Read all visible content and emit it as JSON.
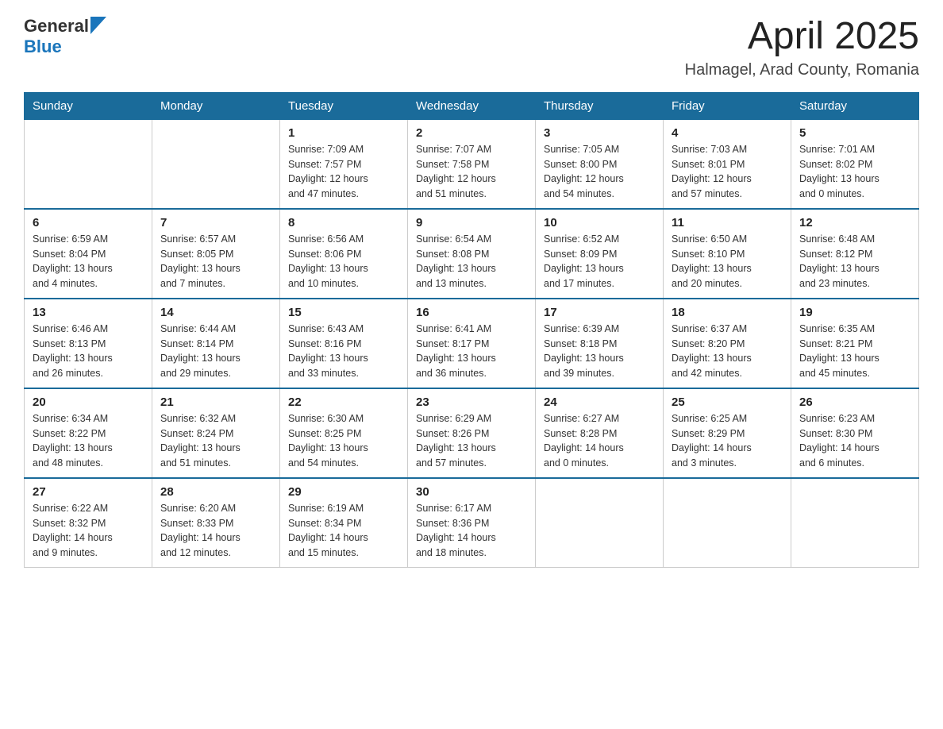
{
  "header": {
    "logo": {
      "general": "General",
      "blue": "Blue"
    },
    "title": "April 2025",
    "location": "Halmagel, Arad County, Romania"
  },
  "calendar": {
    "days_of_week": [
      "Sunday",
      "Monday",
      "Tuesday",
      "Wednesday",
      "Thursday",
      "Friday",
      "Saturday"
    ],
    "weeks": [
      [
        {
          "day": "",
          "info": ""
        },
        {
          "day": "",
          "info": ""
        },
        {
          "day": "1",
          "info": "Sunrise: 7:09 AM\nSunset: 7:57 PM\nDaylight: 12 hours\nand 47 minutes."
        },
        {
          "day": "2",
          "info": "Sunrise: 7:07 AM\nSunset: 7:58 PM\nDaylight: 12 hours\nand 51 minutes."
        },
        {
          "day": "3",
          "info": "Sunrise: 7:05 AM\nSunset: 8:00 PM\nDaylight: 12 hours\nand 54 minutes."
        },
        {
          "day": "4",
          "info": "Sunrise: 7:03 AM\nSunset: 8:01 PM\nDaylight: 12 hours\nand 57 minutes."
        },
        {
          "day": "5",
          "info": "Sunrise: 7:01 AM\nSunset: 8:02 PM\nDaylight: 13 hours\nand 0 minutes."
        }
      ],
      [
        {
          "day": "6",
          "info": "Sunrise: 6:59 AM\nSunset: 8:04 PM\nDaylight: 13 hours\nand 4 minutes."
        },
        {
          "day": "7",
          "info": "Sunrise: 6:57 AM\nSunset: 8:05 PM\nDaylight: 13 hours\nand 7 minutes."
        },
        {
          "day": "8",
          "info": "Sunrise: 6:56 AM\nSunset: 8:06 PM\nDaylight: 13 hours\nand 10 minutes."
        },
        {
          "day": "9",
          "info": "Sunrise: 6:54 AM\nSunset: 8:08 PM\nDaylight: 13 hours\nand 13 minutes."
        },
        {
          "day": "10",
          "info": "Sunrise: 6:52 AM\nSunset: 8:09 PM\nDaylight: 13 hours\nand 17 minutes."
        },
        {
          "day": "11",
          "info": "Sunrise: 6:50 AM\nSunset: 8:10 PM\nDaylight: 13 hours\nand 20 minutes."
        },
        {
          "day": "12",
          "info": "Sunrise: 6:48 AM\nSunset: 8:12 PM\nDaylight: 13 hours\nand 23 minutes."
        }
      ],
      [
        {
          "day": "13",
          "info": "Sunrise: 6:46 AM\nSunset: 8:13 PM\nDaylight: 13 hours\nand 26 minutes."
        },
        {
          "day": "14",
          "info": "Sunrise: 6:44 AM\nSunset: 8:14 PM\nDaylight: 13 hours\nand 29 minutes."
        },
        {
          "day": "15",
          "info": "Sunrise: 6:43 AM\nSunset: 8:16 PM\nDaylight: 13 hours\nand 33 minutes."
        },
        {
          "day": "16",
          "info": "Sunrise: 6:41 AM\nSunset: 8:17 PM\nDaylight: 13 hours\nand 36 minutes."
        },
        {
          "day": "17",
          "info": "Sunrise: 6:39 AM\nSunset: 8:18 PM\nDaylight: 13 hours\nand 39 minutes."
        },
        {
          "day": "18",
          "info": "Sunrise: 6:37 AM\nSunset: 8:20 PM\nDaylight: 13 hours\nand 42 minutes."
        },
        {
          "day": "19",
          "info": "Sunrise: 6:35 AM\nSunset: 8:21 PM\nDaylight: 13 hours\nand 45 minutes."
        }
      ],
      [
        {
          "day": "20",
          "info": "Sunrise: 6:34 AM\nSunset: 8:22 PM\nDaylight: 13 hours\nand 48 minutes."
        },
        {
          "day": "21",
          "info": "Sunrise: 6:32 AM\nSunset: 8:24 PM\nDaylight: 13 hours\nand 51 minutes."
        },
        {
          "day": "22",
          "info": "Sunrise: 6:30 AM\nSunset: 8:25 PM\nDaylight: 13 hours\nand 54 minutes."
        },
        {
          "day": "23",
          "info": "Sunrise: 6:29 AM\nSunset: 8:26 PM\nDaylight: 13 hours\nand 57 minutes."
        },
        {
          "day": "24",
          "info": "Sunrise: 6:27 AM\nSunset: 8:28 PM\nDaylight: 14 hours\nand 0 minutes."
        },
        {
          "day": "25",
          "info": "Sunrise: 6:25 AM\nSunset: 8:29 PM\nDaylight: 14 hours\nand 3 minutes."
        },
        {
          "day": "26",
          "info": "Sunrise: 6:23 AM\nSunset: 8:30 PM\nDaylight: 14 hours\nand 6 minutes."
        }
      ],
      [
        {
          "day": "27",
          "info": "Sunrise: 6:22 AM\nSunset: 8:32 PM\nDaylight: 14 hours\nand 9 minutes."
        },
        {
          "day": "28",
          "info": "Sunrise: 6:20 AM\nSunset: 8:33 PM\nDaylight: 14 hours\nand 12 minutes."
        },
        {
          "day": "29",
          "info": "Sunrise: 6:19 AM\nSunset: 8:34 PM\nDaylight: 14 hours\nand 15 minutes."
        },
        {
          "day": "30",
          "info": "Sunrise: 6:17 AM\nSunset: 8:36 PM\nDaylight: 14 hours\nand 18 minutes."
        },
        {
          "day": "",
          "info": ""
        },
        {
          "day": "",
          "info": ""
        },
        {
          "day": "",
          "info": ""
        }
      ]
    ]
  }
}
